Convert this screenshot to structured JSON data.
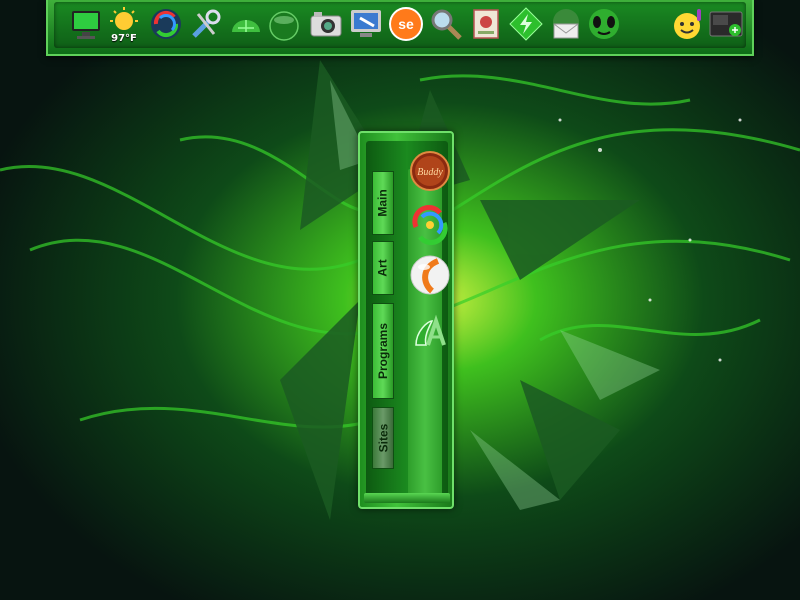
{
  "dock": {
    "weather": {
      "temperature": "97°F",
      "icon": "sun-icon"
    },
    "icons": [
      "monitor-icon",
      "sun-icon",
      "circular-arrows-icon",
      "tools-icon",
      "green-dome-icon",
      "glass-orb-icon",
      "camera-icon",
      "network-monitor-icon",
      "se-icon",
      "search-magnifier-icon",
      "stamp-icon",
      "power-gem-icon",
      "mail-globe-icon",
      "alien-face-icon",
      "smiley-icon",
      "media-box-icon"
    ]
  },
  "panel": {
    "tabs": [
      "Main",
      "Art",
      "Programs",
      "Sites"
    ],
    "active_tab": "Sites",
    "items": [
      "buddy-badge-icon",
      "color-swirl-icon",
      "orange-orb-icon",
      "sa-logo-icon"
    ],
    "badge_text": "Buddy"
  },
  "colors": {
    "accent": "#3fb03b",
    "dark": "#0d6b17",
    "highlight": "#6fe06a"
  }
}
